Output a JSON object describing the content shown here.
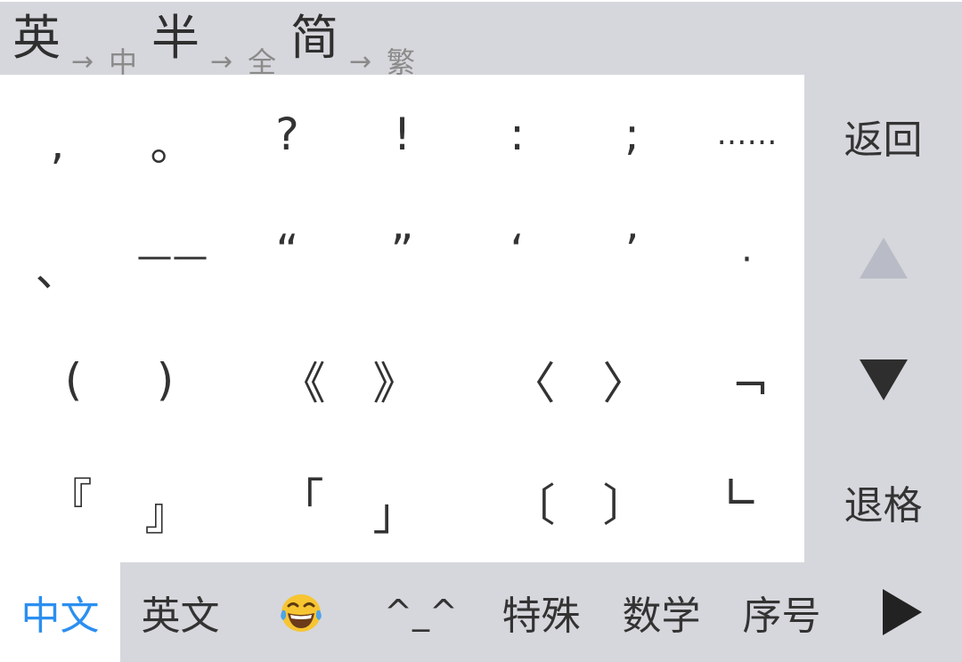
{
  "mode_bar": [
    {
      "current": "英",
      "next": "中"
    },
    {
      "current": "半",
      "next": "全"
    },
    {
      "current": "简",
      "next": "繁"
    }
  ],
  "arrow_glyph": "→",
  "symbols": [
    [
      ",",
      "。",
      "?",
      "!",
      ":",
      ";",
      "……"
    ],
    [
      "、",
      "——",
      "“",
      "”",
      "‘",
      "’",
      "·"
    ],
    [
      "(",
      ")",
      "《",
      "》",
      "〈",
      "〉",
      "¬"
    ],
    [
      "『",
      "』",
      "「",
      "」",
      "〔",
      "〕",
      "∟"
    ]
  ],
  "side": {
    "back_label": "返回",
    "page_up_icon": "triangle-up-icon",
    "page_down_icon": "triangle-down-icon",
    "backspace_label": "退格"
  },
  "tabs": {
    "chinese": "中文",
    "english": "英文",
    "emoji_icon": "laughing-tears-emoji",
    "kaomoji": "^_^",
    "special": "特殊",
    "math": "数学",
    "ordinal": "序号",
    "more_icon": "play-right-icon",
    "active": "中文"
  },
  "colors": {
    "active_tab_text": "#2b8ff0",
    "panel_gray": "#d6d7dc",
    "disabled_arrow": "#b9bcc6"
  }
}
